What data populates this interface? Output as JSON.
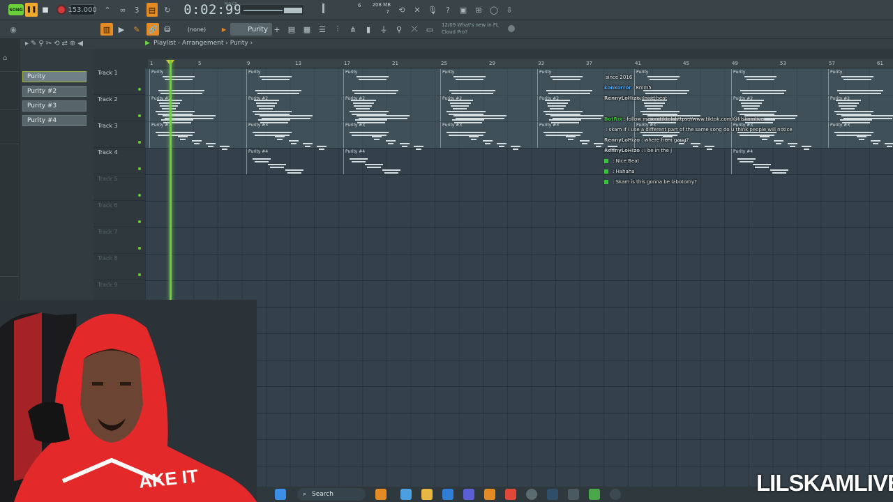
{
  "transport": {
    "song_mode": "SONG",
    "tempo": "153.000",
    "time": "0:02:99",
    "time_small": "M:S:CS",
    "cpu_mem": "208 MB",
    "cpu_num": "6",
    "cpu_poly": "7"
  },
  "toolbar2": {
    "pattern_none": "(none)",
    "pattern_name": "Purity",
    "news_line1": "12/09  What's new in FL",
    "news_line2": "Cloud Pro?"
  },
  "playlist": {
    "title": "Playlist - Arrangement",
    "crumb": "Purity",
    "ruler": [
      "1",
      "5",
      "9",
      "13",
      "17",
      "21",
      "25",
      "29",
      "33",
      "37",
      "41",
      "45",
      "49",
      "53",
      "57",
      "61"
    ],
    "tracks": [
      "Track 1",
      "Track 2",
      "Track 3",
      "Track 4",
      "Track 5",
      "Track 6",
      "Track 7",
      "Track 8",
      "Track 9"
    ],
    "patterns": [
      "Purity",
      "Purity #2",
      "Purity #3",
      "Purity #4"
    ]
  },
  "clips": {
    "t1": "Purity",
    "t2": "Purity #2",
    "t3": "Purity #3",
    "t4": "Purity #4"
  },
  "chat": [
    {
      "user": "",
      "msg": "since 2016",
      "color": "#ff5a5a"
    },
    {
      "user": "konkorror",
      "msg": ": 8mm5",
      "color": "#4fb0ff"
    },
    {
      "user": "RennyLoHizo",
      "msg": ": nice beat",
      "color": "#c9d1d4"
    },
    {
      "user": "",
      "msg": "",
      "color": "#ff5a5a"
    },
    {
      "user": "BotRix",
      "msg": ": follow me on tiktok https://www.tiktok.com/@lilskamlive",
      "color": "#35c43a"
    },
    {
      "user": "",
      "msg": ": skam if i use a different part of the same song do u think people will notice",
      "color": "#4fb0ff"
    },
    {
      "user": "RennyLoHizo",
      "msg": ": where from gang?",
      "color": "#c9d1d4"
    },
    {
      "user": "RennyLoHizo",
      "msg": ": i be in the j",
      "color": "#c9d1d4"
    },
    {
      "user": "",
      "msg": ": Nice Beat",
      "color": "#b04fff"
    },
    {
      "user": "",
      "msg": ": Hahaha",
      "color": "#b04fff"
    },
    {
      "user": "",
      "msg": ": Skam is this gonna be labotomy?",
      "color": "#b04fff"
    }
  ],
  "taskbar": {
    "search": "Search"
  },
  "watermark": "LILSKAMLIVE",
  "colors": {
    "accent_green": "#6bd03a",
    "accent_orange": "#e48b26",
    "record_red": "#d33a3a"
  }
}
